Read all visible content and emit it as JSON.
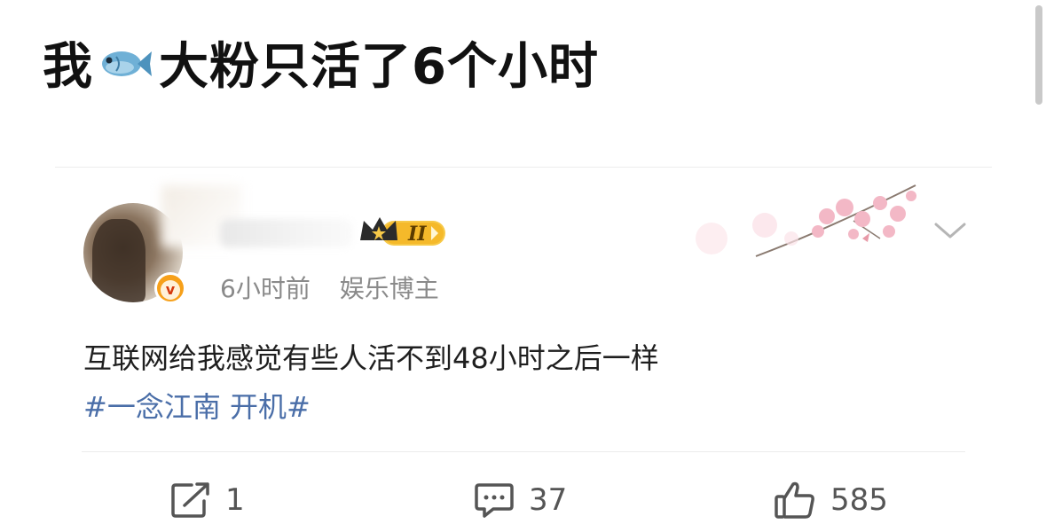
{
  "headline": {
    "text_before_icon": "我",
    "icon": "fish-icon",
    "text_after_icon": "大粉只活了6个小时"
  },
  "post": {
    "author_badge_text": "II",
    "timestamp": "6小时前",
    "author_type": "娱乐博主",
    "verified_icon": "verified-v-icon",
    "verified_text": "v",
    "body": "互联网给我感觉有些人活不到48小时之后一样",
    "hashtag": "#一念江南 开机#",
    "actions": {
      "repost": {
        "icon": "share-icon",
        "count": "1"
      },
      "comment": {
        "icon": "comment-icon",
        "count": "37"
      },
      "like": {
        "icon": "thumbs-up-icon",
        "count": "585"
      }
    }
  },
  "colors": {
    "link_blue": "#4a6ea8",
    "meta_gray": "#8a8a8a",
    "badge_gold": "#f6a01a"
  }
}
